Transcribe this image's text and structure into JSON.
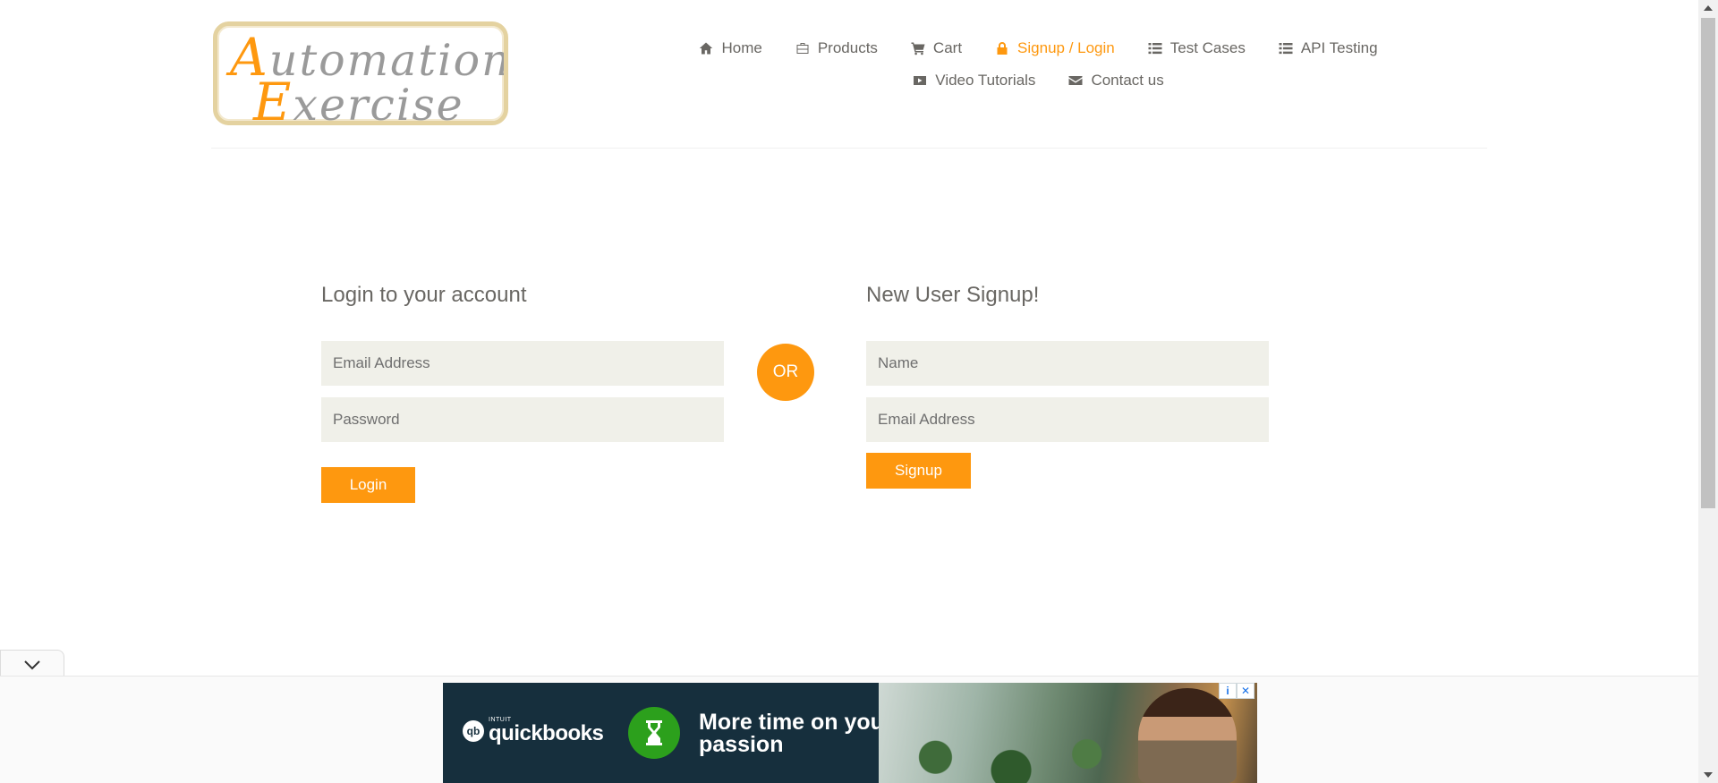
{
  "brand": {
    "logo_line1_cap": "A",
    "logo_line1_rest": "utomation",
    "logo_line2_cap": "E",
    "logo_line2_rest": "xercise"
  },
  "nav": {
    "items": [
      {
        "label": "Home",
        "icon": "home-icon"
      },
      {
        "label": "Products",
        "icon": "briefcase-icon"
      },
      {
        "label": "Cart",
        "icon": "cart-icon"
      },
      {
        "label": "Signup / Login",
        "icon": "lock-icon",
        "active": true
      },
      {
        "label": "Test Cases",
        "icon": "list-icon"
      },
      {
        "label": "API Testing",
        "icon": "list-icon"
      },
      {
        "label": "Video Tutorials",
        "icon": "youtube-icon"
      },
      {
        "label": "Contact us",
        "icon": "envelope-icon"
      }
    ]
  },
  "login": {
    "title": "Login to your account",
    "email_placeholder": "Email Address",
    "password_placeholder": "Password",
    "button_label": "Login"
  },
  "separator": {
    "label": "OR"
  },
  "signup": {
    "title": "New User Signup!",
    "name_placeholder": "Name",
    "email_placeholder": "Email Address",
    "button_label": "Signup"
  },
  "ad": {
    "brand_small": "INTUIT",
    "brand_name": "quickbooks",
    "brand_glyph": "qb",
    "headline": "More time on your passion",
    "info_glyph": "i",
    "close_glyph": "✕"
  },
  "colors": {
    "accent": "#fe980f",
    "input_bg": "#f0f0e9",
    "text": "#696763"
  }
}
